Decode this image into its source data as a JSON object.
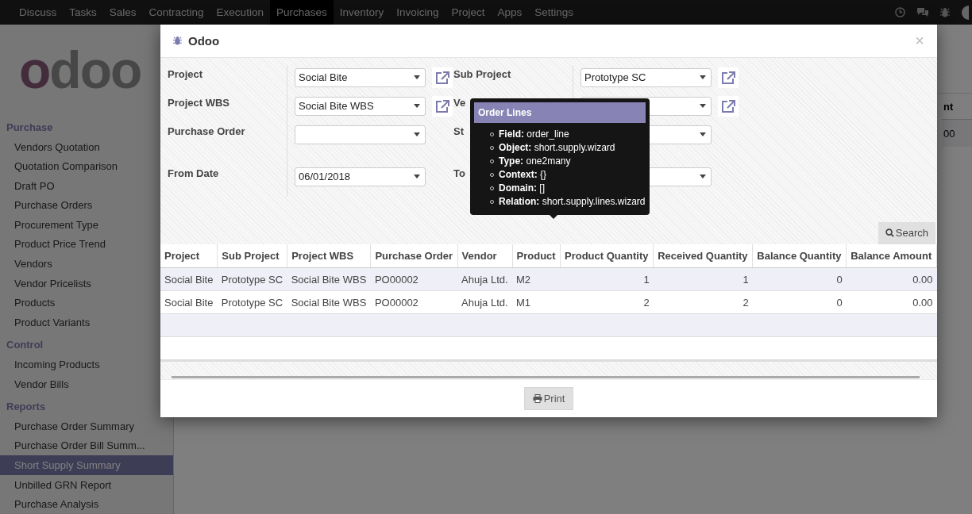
{
  "navbar": {
    "items": [
      {
        "label": "Discuss",
        "selected": false
      },
      {
        "label": "Tasks",
        "selected": false
      },
      {
        "label": "Sales",
        "selected": false
      },
      {
        "label": "Contracting",
        "selected": false
      },
      {
        "label": "Execution",
        "selected": false
      },
      {
        "label": "Purchases",
        "selected": true
      },
      {
        "label": "Inventory",
        "selected": false
      },
      {
        "label": "Invoicing",
        "selected": false
      },
      {
        "label": "Project",
        "selected": false
      },
      {
        "label": "Apps",
        "selected": false
      },
      {
        "label": "Settings",
        "selected": false
      }
    ]
  },
  "sidebar": {
    "logo": "odoo",
    "sections": [
      {
        "title": "Purchase",
        "items": [
          {
            "label": "Vendors Quotation",
            "selected": false
          },
          {
            "label": "Quotation Comparison",
            "selected": false
          },
          {
            "label": "Draft PO",
            "selected": false
          },
          {
            "label": "Purchase Orders",
            "selected": false
          },
          {
            "label": "Procurement Type",
            "selected": false
          },
          {
            "label": "Product Price Trend",
            "selected": false
          },
          {
            "label": "Vendors",
            "selected": false
          },
          {
            "label": "Vendor Pricelists",
            "selected": false
          },
          {
            "label": "Products",
            "selected": false
          },
          {
            "label": "Product Variants",
            "selected": false
          }
        ]
      },
      {
        "title": "Control",
        "items": [
          {
            "label": "Incoming Products",
            "selected": false
          },
          {
            "label": "Vendor Bills",
            "selected": false
          }
        ]
      },
      {
        "title": "Reports",
        "items": [
          {
            "label": "Purchase Order Summary",
            "selected": false
          },
          {
            "label": "Purchase Order Bill Summ...",
            "selected": false
          },
          {
            "label": "Short Supply Summary",
            "selected": true
          },
          {
            "label": "Unbilled GRN Report",
            "selected": false
          },
          {
            "label": "Purchase Analysis",
            "selected": false
          }
        ]
      }
    ]
  },
  "background_table": {
    "column": "nt",
    "cell": "00"
  },
  "dialog": {
    "title": "Odoo",
    "close_button": "×",
    "form_rows": [
      [
        {
          "label": "Project",
          "value": "Social Bite",
          "external_link": true
        },
        {
          "label": "Sub Project",
          "value": "Prototype SC",
          "external_link": true
        }
      ],
      [
        {
          "label": "Project WBS",
          "value": "Social Bite WBS",
          "external_link": true
        },
        {
          "label": "Ve",
          "external_link": true
        }
      ],
      [
        {
          "label": "Purchase Order",
          "external_link": false
        },
        {
          "label": "St",
          "external_link": false
        }
      ],
      [
        {
          "label": "From Date",
          "value": "06/01/2018",
          "external_link": false
        },
        {
          "label": "To",
          "external_link": false
        }
      ]
    ],
    "search_button": "Search",
    "tooltip": {
      "title": "Order Lines",
      "lines": [
        "**Field:** order_line",
        "**Object:** short.supply.wizard",
        "**Type:** one2many",
        "**Context:** {}",
        "**Domain:** []",
        "**Relation:** short.supply.lines.wizard"
      ]
    },
    "table": {
      "columns": [
        {
          "label": "Project",
          "numeric": false
        },
        {
          "label": "Sub Project",
          "numeric": false
        },
        {
          "label": "Project WBS",
          "numeric": false
        },
        {
          "label": "Purchase Order",
          "numeric": false
        },
        {
          "label": "Vendor",
          "numeric": false
        },
        {
          "label": "Product",
          "numeric": false
        },
        {
          "label": "Product Quantity",
          "numeric": true
        },
        {
          "label": "Received Quantity",
          "numeric": true
        },
        {
          "label": "Balance Quantity",
          "numeric": true
        },
        {
          "label": "Balance Amount",
          "numeric": true
        }
      ],
      "rows": [
        [
          "Social Bite",
          "Prototype SC",
          "Social Bite WBS",
          "PO00002",
          "Ahuja Ltd.",
          "M2",
          "1",
          "1",
          "0",
          "0.00"
        ],
        [
          "Social Bite",
          "Prototype SC",
          "Social Bite WBS",
          "PO00002",
          "Ahuja Ltd.",
          "M1",
          "2",
          "2",
          "0",
          "0.00"
        ]
      ]
    },
    "print_button": "Print"
  }
}
